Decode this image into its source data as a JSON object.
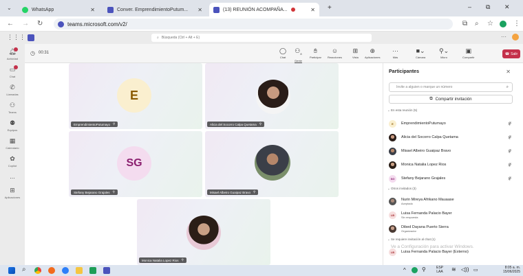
{
  "browser": {
    "tabs": [
      {
        "label": "WhatsApp",
        "color": "#25d366"
      },
      {
        "label": "Conver. EmprendimientoPutum...",
        "color": "#4b53bc"
      },
      {
        "label": "(13) REUNIÓN ACOMPAÑA...",
        "color": "#4b53bc"
      }
    ],
    "url": "teams.microsoft.com/v2/"
  },
  "teams": {
    "search_placeholder": "Búsqueda (Ctrl + Alt + E)",
    "rail": [
      {
        "label": "Actividad",
        "icon": "bell-icon"
      },
      {
        "label": "Chat",
        "icon": "chat-icon"
      },
      {
        "label": "Llamadas",
        "icon": "phone-icon"
      },
      {
        "label": "Teams",
        "icon": "teams-icon"
      },
      {
        "label": "Equipos",
        "icon": "people-icon"
      },
      {
        "label": "Calendario",
        "icon": "calendar-icon"
      },
      {
        "label": "Copilot",
        "icon": "copilot-icon"
      },
      {
        "label": "...",
        "icon": "more-icon"
      },
      {
        "label": "Aplicaciones",
        "icon": "apps-icon"
      }
    ],
    "meeting_timer": "00:31",
    "toolbar": [
      {
        "label": "Chat",
        "icon": "chat-icon"
      },
      {
        "label": "Gente",
        "icon": "people-icon",
        "count": "8"
      },
      {
        "label": "Participar",
        "icon": "hand-icon"
      },
      {
        "label": "Reacciones",
        "icon": "emoji-icon"
      },
      {
        "label": "Vista",
        "icon": "grid-icon"
      },
      {
        "label": "Aplicaciones",
        "icon": "apps-icon"
      },
      {
        "label": "Más",
        "icon": "more-icon"
      },
      {
        "label": "Cámara",
        "icon": "camera-icon"
      },
      {
        "label": "Micro",
        "icon": "mic-icon"
      },
      {
        "label": "Compartir",
        "icon": "share-icon"
      }
    ],
    "leave_label": "Salir"
  },
  "tiles": [
    {
      "name": "EmprendimientoPutumayo",
      "initials": "E",
      "avatar_bg": "#faefcf",
      "initials_color": "#8a5a00"
    },
    {
      "name": "Alicia del Socorro Calpa Quetama",
      "photo": true
    },
    {
      "name": "Stefany Bejarano Grajales",
      "initials": "SG",
      "avatar_bg": "#f4dcef",
      "initials_color": "#8b1f6f"
    },
    {
      "name": "Misael Albeiro Guaipaz Bravo",
      "photo": true
    },
    {
      "name": "Monica Natalia Lopez Rios",
      "photo": true
    }
  ],
  "panel": {
    "title": "Participantes",
    "invite_placeholder": "Invite a alguien o marque un número",
    "share_label": "Compartir invitación",
    "in_meeting_header": "En esta reunión (5)",
    "in_meeting": [
      {
        "name": "EmprendimientoPutumayo",
        "initials": "E",
        "bg": "#faefcf",
        "fg": "#8a5a00"
      },
      {
        "name": "Alicia del Socorro Calpa Quetama",
        "photo": true
      },
      {
        "name": "Misael Albeiro Guaipaz Bravo",
        "photo": true
      },
      {
        "name": "Monica Natalia Lopez Rios",
        "photo": true
      },
      {
        "name": "Stefany Bejarano Grajales",
        "initials": "SG",
        "bg": "#f4dcef",
        "fg": "#8b1f6f"
      }
    ],
    "invited_header": "Otros invitados (3)",
    "invited": [
      {
        "name": "Nurin Mireya Afrikano Mauaase",
        "status": "Aceptado",
        "photo": true
      },
      {
        "name": "Luisa Fernanda Palacio Bayer",
        "status": "Sin respuesta",
        "initials": "LB",
        "bg": "#f6dede",
        "fg": "#a4262c"
      },
      {
        "name": "Dibed Dayana Puerto Sierra",
        "status": "Organizador",
        "photo": true
      }
    ],
    "lobby_header": "Se requiere invitación al chat (1)",
    "lobby": [
      {
        "name": "Luisa Fernanda Palacio Bayer (Externo)",
        "initials": "LB",
        "bg": "#f6dede",
        "fg": "#a4262c"
      }
    ],
    "watermark": "Ve a Configuración para activar Windows."
  },
  "taskbar": {
    "lang": "ESP",
    "lang2": "LAA",
    "time": "8:05 a. m.",
    "date": "15/06/2025"
  }
}
